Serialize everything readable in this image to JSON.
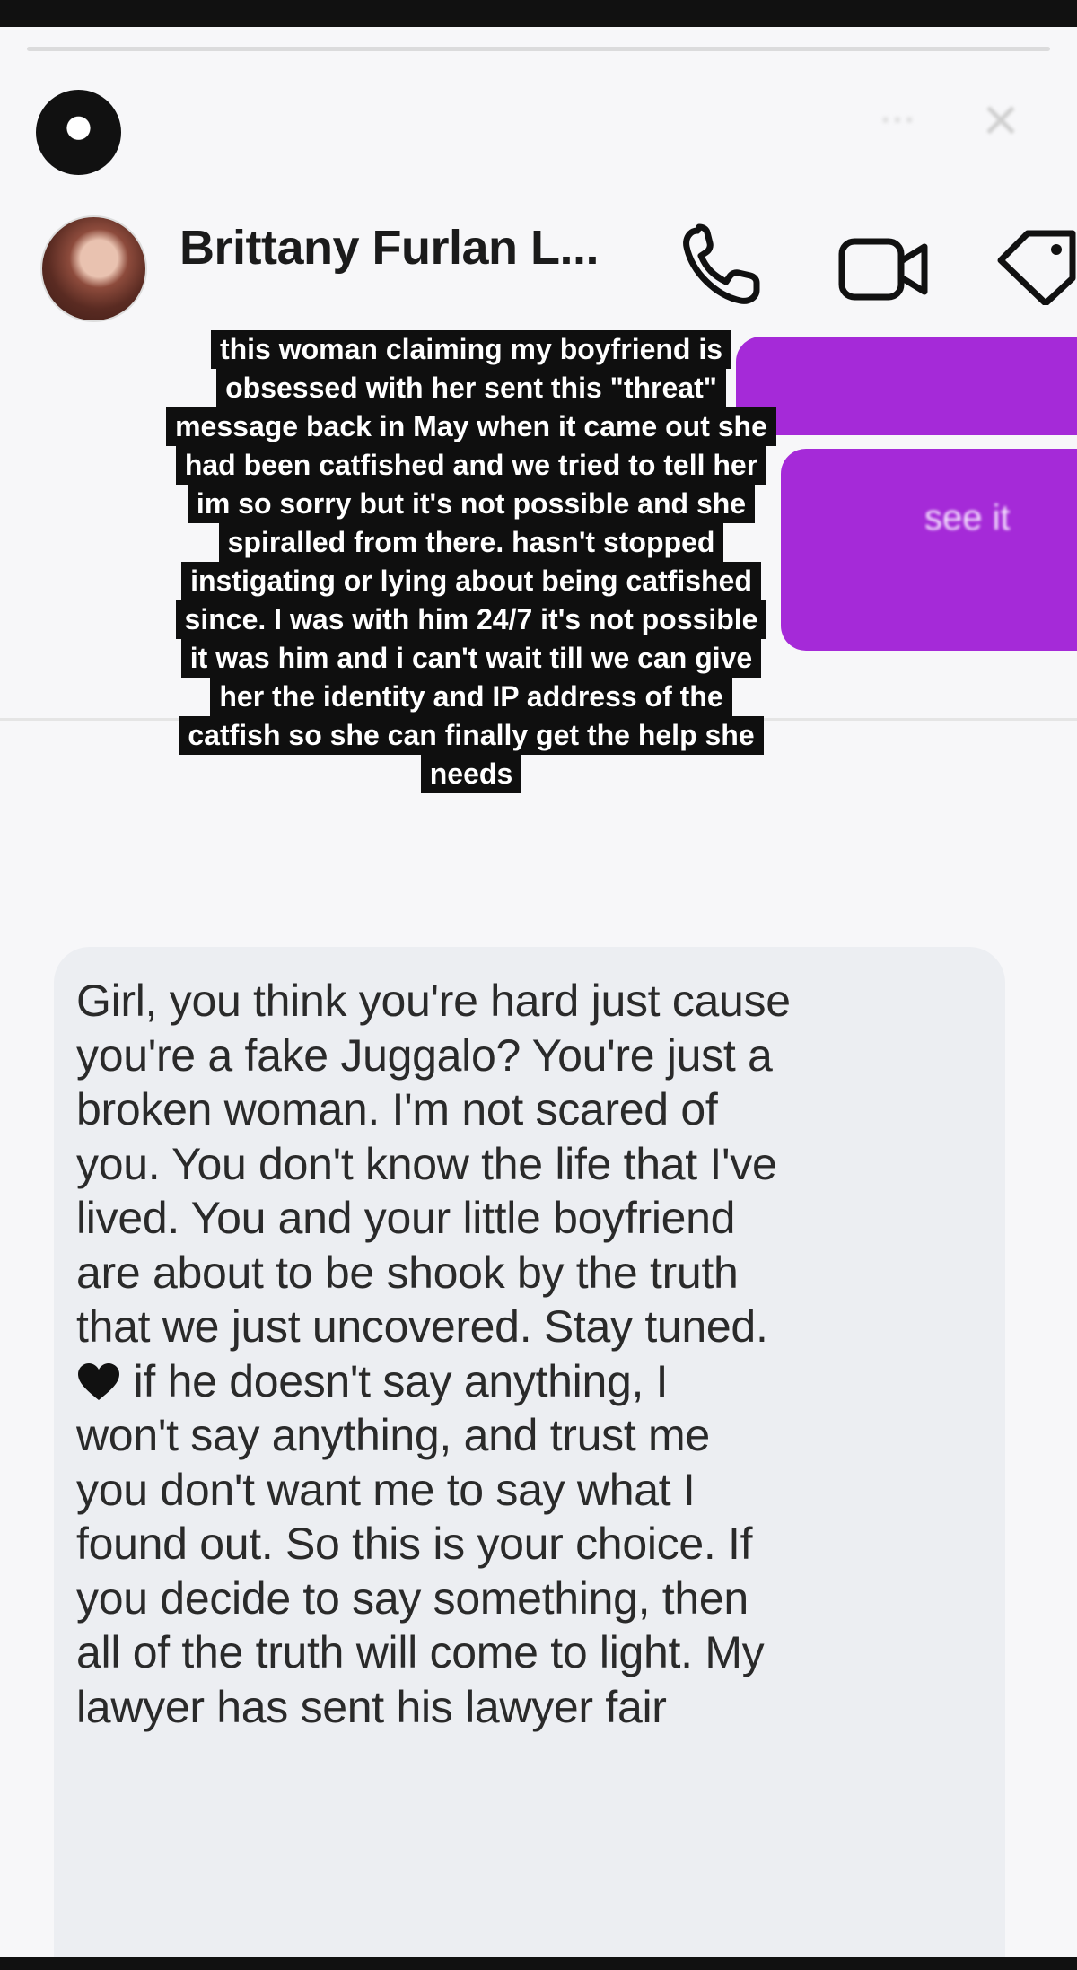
{
  "story": {
    "progress": 0.0,
    "user": "",
    "time": "",
    "more_icon": "more-icon",
    "close_icon": "close-icon"
  },
  "dm": {
    "name": "Brittany Furlan L...",
    "handle": "",
    "icons": [
      "phone-icon",
      "video-camera-icon",
      "tag-icon"
    ],
    "purple_text_1": "",
    "purple_text_2": "see it"
  },
  "caption": {
    "lines": [
      "this woman claiming my boyfriend is",
      "obsessed with her sent this \"threat\"",
      "message back in May when it came out she",
      "had been catfished and we tried to tell her",
      "im so sorry but it's not possible and she",
      "spiralled from there. hasn't stopped",
      "instigating or lying about being catfished",
      "since. I was with him 24/7 it's not possible",
      "it was him and i can't wait till we can give",
      "her the identity and IP address of the",
      "catfish so she can finally get the help she",
      "needs"
    ]
  },
  "message": {
    "lines": [
      "Girl, you think you're hard just cause",
      "you're a fake Juggalo? You're just a",
      "broken woman. I'm not scared of",
      "you. You don't know the life that I've",
      "lived. You and your little boyfriend",
      "are about to be shook by the truth",
      "that we just uncovered. Stay tuned.",
      " if he doesn't say anything, I",
      "won't say anything, and trust me",
      "you don't want me to say what I",
      "found out. So this is your choice. If",
      "you decide to say something, then",
      "all of the truth will come to light. My",
      "lawyer has sent his lawyer fair"
    ],
    "heart_icon": "black-heart-icon"
  },
  "colors": {
    "bubble": "#eceef2",
    "purple": "#a52ad8",
    "caption_bg": "#0f0f0f"
  }
}
